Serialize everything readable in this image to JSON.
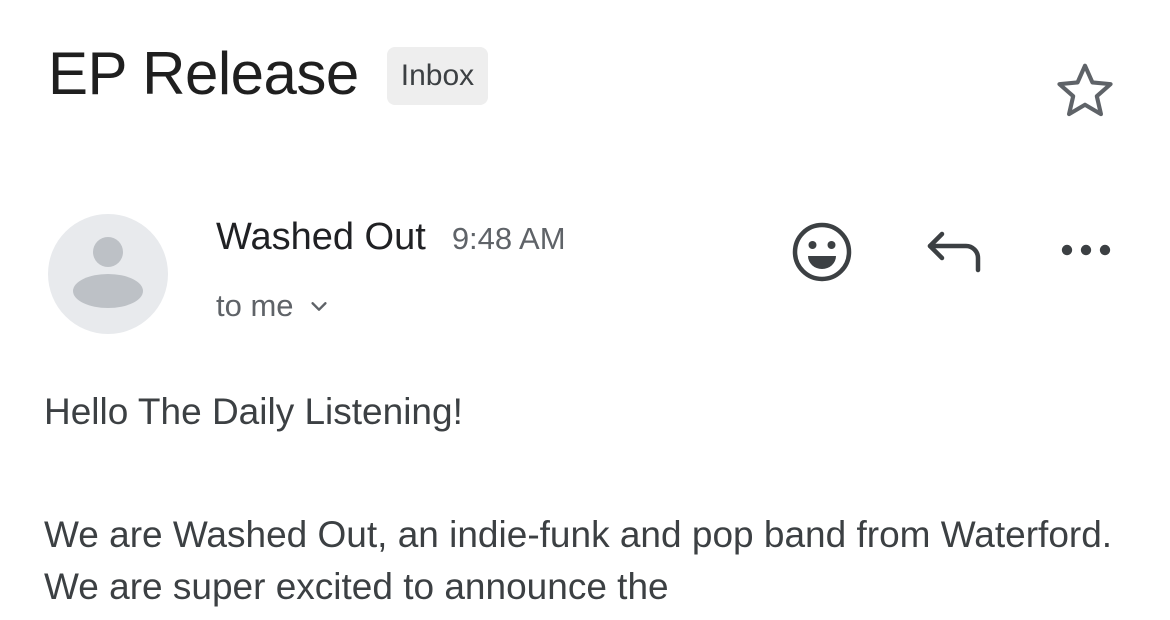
{
  "email": {
    "subject": "EP Release",
    "label": "Inbox",
    "sender_name": "Washed Out",
    "sent_time": "9:48 AM",
    "recipients": "to me",
    "body": {
      "greeting": "Hello The Daily Listening!",
      "paragraph_1": "We are Washed Out, an indie-funk and pop band from Waterford. We are super excited to announce the"
    }
  },
  "icons": {
    "star": "star-outline-icon",
    "avatar": "person-placeholder-icon",
    "recipients_toggle": "chevron-down-icon",
    "emoji": "emoji-reaction-icon",
    "reply": "reply-icon",
    "more": "more-horizontal-icon"
  },
  "colors": {
    "text_primary": "#202124",
    "text_secondary": "#5f6368",
    "chip_background": "#eeeeee",
    "avatar_background": "#e8eaed",
    "avatar_glyph": "#bdc1c6",
    "icon": "#3c4043"
  }
}
